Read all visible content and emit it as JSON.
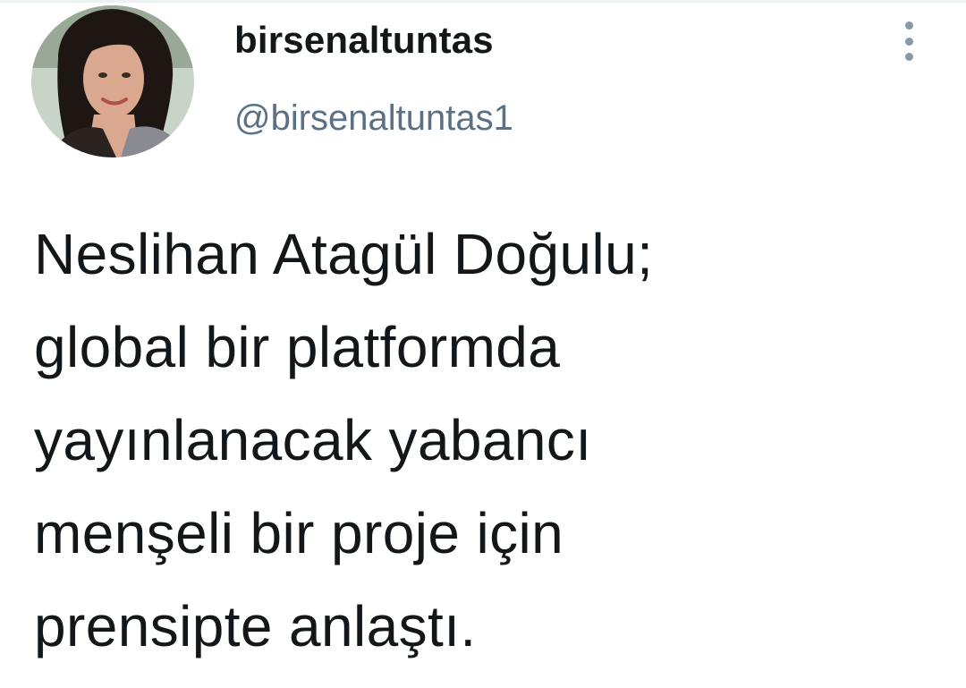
{
  "tweet": {
    "author": {
      "display_name": "birsenaltuntas",
      "handle": "@birsenaltuntas1",
      "avatar_icon": "profile-photo"
    },
    "more_icon": "vertical-ellipsis-icon",
    "text_lines": [
      "Neslihan Atagül Doğulu;",
      "global bir platformda",
      "yayınlanacak yabancı",
      "menşeli bir proje için",
      "prensipte anlaştı."
    ]
  },
  "colors": {
    "text_primary": "#14171a",
    "text_secondary": "#5b7083",
    "icon_gray": "#8899a6",
    "background": "#ffffff"
  }
}
